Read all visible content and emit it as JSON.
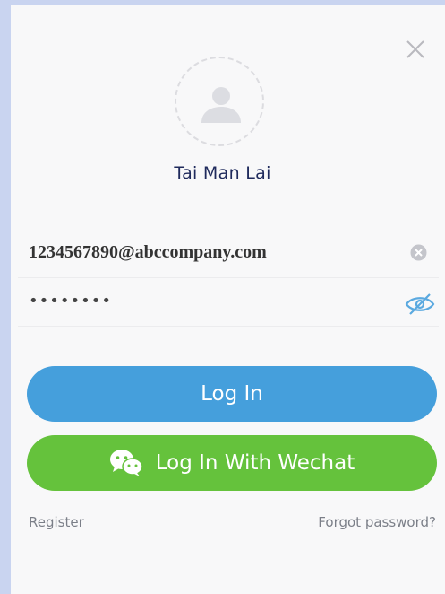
{
  "profile": {
    "name": "Tai Man Lai",
    "avatar_icon": "user-placeholder-icon"
  },
  "header": {
    "close_icon": "close-icon"
  },
  "form": {
    "email_value": "1234567890@abccompany.com",
    "password_value": "••••••••",
    "clear_icon": "clear-circle-icon",
    "visibility_icon": "eye-off-icon"
  },
  "buttons": {
    "login_label": "Log In",
    "wechat_label": "Log In With Wechat",
    "wechat_icon": "wechat-icon"
  },
  "links": {
    "register": "Register",
    "forgot_password": "Forgot password?"
  },
  "colors": {
    "login_button": "#459fdc",
    "wechat_button": "#65c23c",
    "eye_icon": "#5aa9e0",
    "name_text": "#1f2a5c"
  }
}
